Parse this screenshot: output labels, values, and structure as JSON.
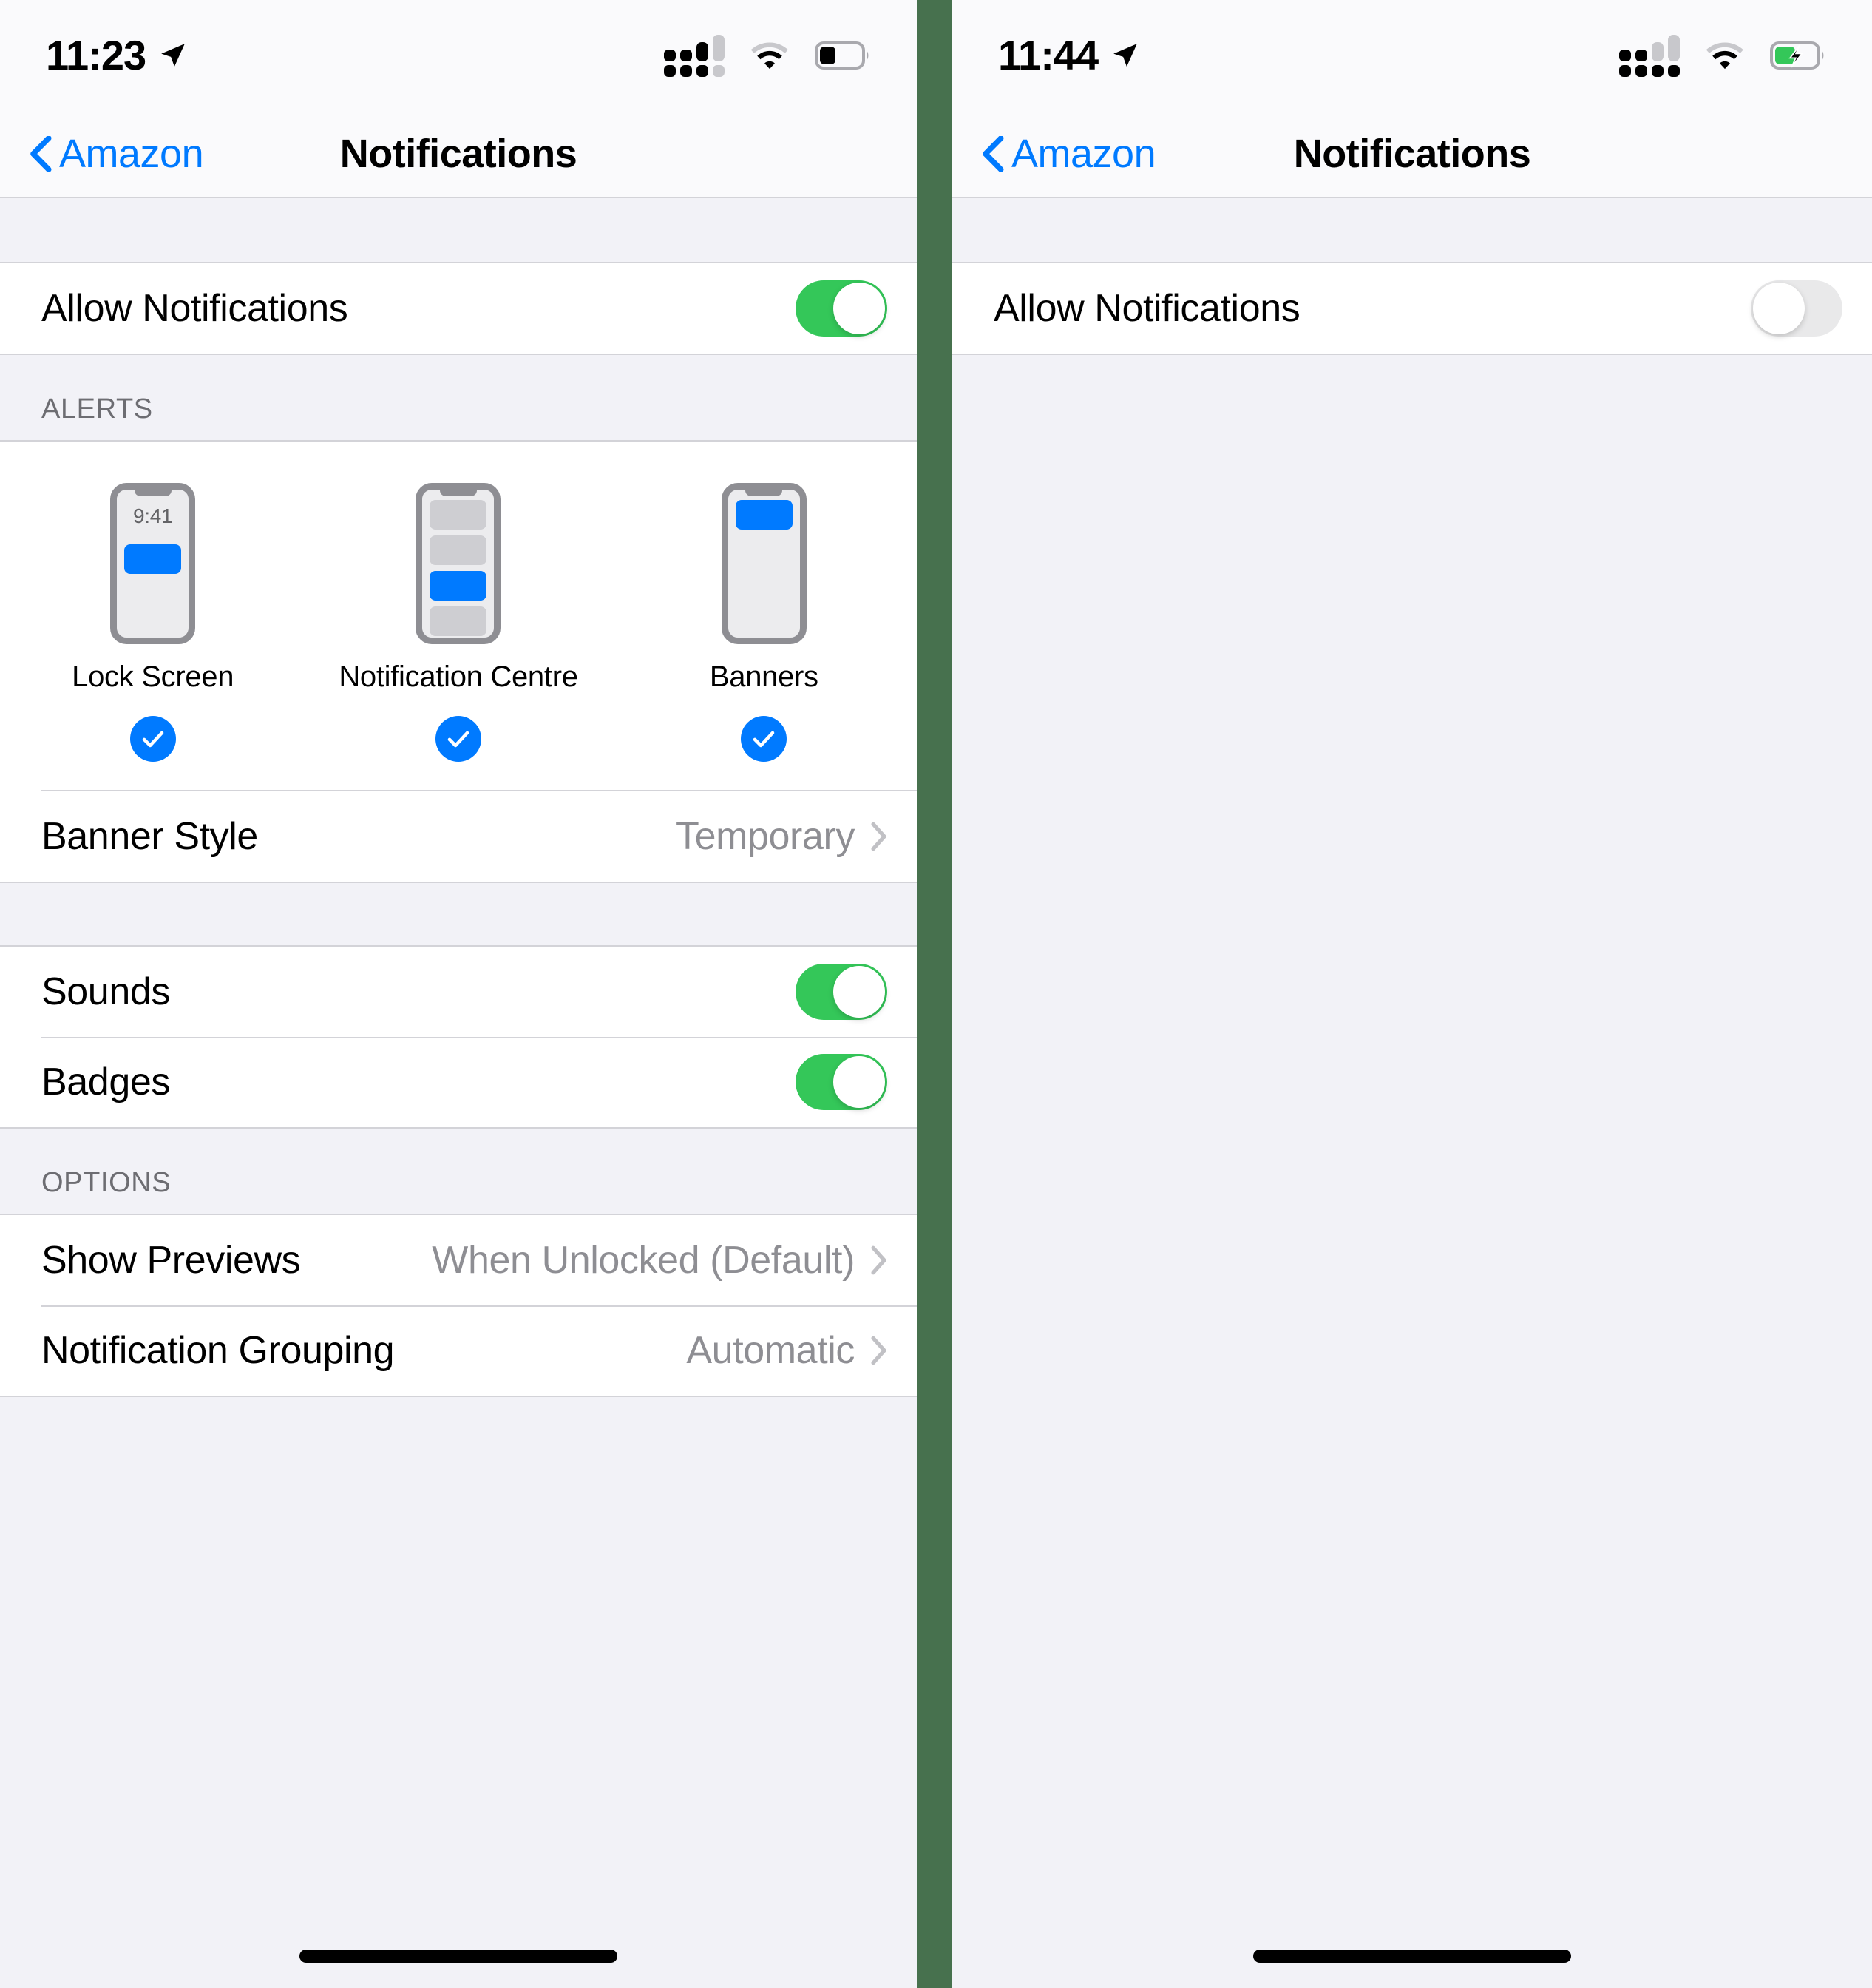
{
  "colors": {
    "accent_blue": "#007AFF",
    "toggle_on_green": "#34C759",
    "toggle_off_grey": "#E9E9EA",
    "divider_green": "#47714E",
    "group_bg": "#F2F2F7",
    "value_grey": "#8E8E93"
  },
  "left_panel": {
    "status_bar": {
      "time": "11:23",
      "location_icon": "location-arrow-icon",
      "signal_icon": "cellular-signal-icon",
      "signal_bars_filled": 3,
      "signal_bars_total": 4,
      "wifi_icon": "wifi-icon",
      "battery_icon": "battery-icon",
      "battery_charging": false,
      "battery_level_pct": 35
    },
    "nav": {
      "back_icon": "chevron-left-icon",
      "back_label": "Amazon",
      "title": "Notifications"
    },
    "allow_row": {
      "label": "Allow Notifications",
      "toggle_state": "on"
    },
    "alerts_section": {
      "header": "ALERTS",
      "options": [
        {
          "label": "Lock Screen",
          "selected": true,
          "preview": "lock-screen",
          "preview_time": "9:41"
        },
        {
          "label": "Notification Centre",
          "selected": true,
          "preview": "notification-centre"
        },
        {
          "label": "Banners",
          "selected": true,
          "preview": "banners"
        }
      ],
      "banner_style": {
        "label": "Banner Style",
        "value": "Temporary",
        "chevron": "chevron-right-icon"
      }
    },
    "sound_section": [
      {
        "label": "Sounds",
        "toggle_state": "on"
      },
      {
        "label": "Badges",
        "toggle_state": "on"
      }
    ],
    "options_section": {
      "header": "OPTIONS",
      "rows": [
        {
          "label": "Show Previews",
          "value": "When Unlocked (Default)",
          "chevron": "chevron-right-icon"
        },
        {
          "label": "Notification Grouping",
          "value": "Automatic",
          "chevron": "chevron-right-icon"
        }
      ]
    }
  },
  "right_panel": {
    "status_bar": {
      "time": "11:44",
      "location_icon": "location-arrow-icon",
      "signal_icon": "cellular-signal-icon",
      "signal_bars_filled": 2,
      "signal_bars_total": 4,
      "wifi_icon": "wifi-icon",
      "battery_icon": "battery-charging-icon",
      "battery_charging": true,
      "battery_level_pct": 45
    },
    "nav": {
      "back_icon": "chevron-left-icon",
      "back_label": "Amazon",
      "title": "Notifications"
    },
    "allow_row": {
      "label": "Allow Notifications",
      "toggle_state": "off"
    }
  }
}
